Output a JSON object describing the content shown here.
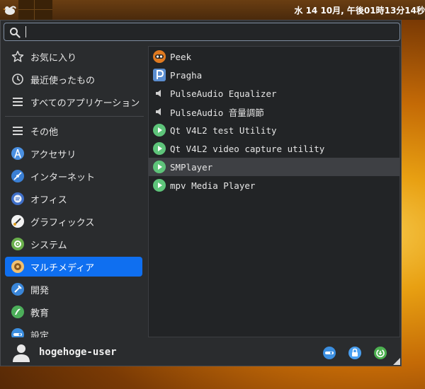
{
  "panel": {
    "clock": "水 14 10月, 午後01時13分14秒"
  },
  "search": {
    "value": "",
    "placeholder": ""
  },
  "categories": [
    {
      "label": "お気に入り",
      "icon": "star-icon"
    },
    {
      "label": "最近使ったもの",
      "icon": "clock-icon"
    },
    {
      "label": "すべてのアプリケーション",
      "icon": "list-icon"
    },
    {
      "label": "その他",
      "icon": "list-icon"
    },
    {
      "label": "アクセサリ",
      "icon": "accessories-icon"
    },
    {
      "label": "インターネット",
      "icon": "internet-icon"
    },
    {
      "label": "オフィス",
      "icon": "office-icon"
    },
    {
      "label": "グラフィックス",
      "icon": "graphics-icon"
    },
    {
      "label": "システム",
      "icon": "system-icon"
    },
    {
      "label": "マルチメディア",
      "icon": "multimedia-icon",
      "selected": true
    },
    {
      "label": "開発",
      "icon": "development-icon"
    },
    {
      "label": "教育",
      "icon": "education-icon"
    },
    {
      "label": "設定",
      "icon": "settings-icon"
    }
  ],
  "apps": [
    {
      "label": "Peek",
      "icon": "peek-icon"
    },
    {
      "label": "Pragha",
      "icon": "pragha-icon"
    },
    {
      "label": "PulseAudio Equalizer",
      "icon": "speaker-icon"
    },
    {
      "label": "PulseAudio 音量調節",
      "icon": "speaker-icon"
    },
    {
      "label": "Qt V4L2 test Utility",
      "icon": "play-icon"
    },
    {
      "label": "Qt V4L2 video capture utility",
      "icon": "play-icon"
    },
    {
      "label": "SMPlayer",
      "icon": "play-icon",
      "selected": true
    },
    {
      "label": "mpv Media Player",
      "icon": "play-icon"
    }
  ],
  "footer": {
    "username": "hogehoge-user"
  },
  "colors": {
    "selection": "#0f6ff0",
    "menu_bg": "#2a2c2e",
    "play_green": "#5ec47a",
    "settings_blue": "#3c8fe0",
    "lock_blue": "#4a9ff0",
    "logout_green": "#4cb050"
  }
}
